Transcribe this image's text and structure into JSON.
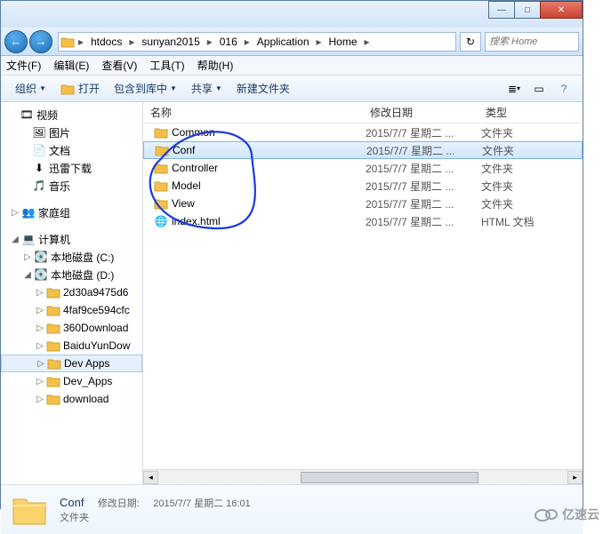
{
  "window": {
    "min": "—",
    "max": "□",
    "close": "✕"
  },
  "nav": {
    "back": "←",
    "fwd": "→",
    "refresh": "↻"
  },
  "breadcrumb": [
    "htdocs",
    "sunyan2015",
    "016",
    "Application",
    "Home"
  ],
  "search": {
    "placeholder": "搜索 Home"
  },
  "menu": {
    "file": "文件(F)",
    "edit": "编辑(E)",
    "view": "查看(V)",
    "tools": "工具(T)",
    "help": "帮助(H)"
  },
  "toolbar": {
    "organize": "组织",
    "open": "打开",
    "include": "包含到库中",
    "share": "共享",
    "newfolder": "新建文件夹"
  },
  "sidebar": {
    "video": "视频",
    "pictures": "图片",
    "documents": "文档",
    "xunlei": "迅雷下载",
    "music": "音乐",
    "homegroup": "家庭组",
    "computer": "计算机",
    "driveC": "本地磁盘 (C:)",
    "driveD": "本地磁盘 (D:)",
    "d1": "2d30a9475d6",
    "d2": "4faf9ce594cfc",
    "d3": "360Download",
    "d4": "BaiduYunDow",
    "d5": "Dev Apps",
    "d6": "Dev_Apps",
    "d7": "download"
  },
  "columns": {
    "name": "名称",
    "date": "修改日期",
    "type": "类型"
  },
  "files": [
    {
      "name": "Common",
      "date": "2015/7/7 星期二 ...",
      "type": "文件夹",
      "icon": "folder",
      "selected": false
    },
    {
      "name": "Conf",
      "date": "2015/7/7 星期二 ...",
      "type": "文件夹",
      "icon": "folder",
      "selected": true
    },
    {
      "name": "Controller",
      "date": "2015/7/7 星期二 ...",
      "type": "文件夹",
      "icon": "folder",
      "selected": false
    },
    {
      "name": "Model",
      "date": "2015/7/7 星期二 ...",
      "type": "文件夹",
      "icon": "folder",
      "selected": false
    },
    {
      "name": "View",
      "date": "2015/7/7 星期二 ...",
      "type": "文件夹",
      "icon": "folder",
      "selected": false
    },
    {
      "name": "index.html",
      "date": "2015/7/7 星期二 ...",
      "type": "HTML 文档",
      "icon": "html",
      "selected": false
    }
  ],
  "details": {
    "name": "Conf",
    "type": "文件夹",
    "modlabel": "修改日期:",
    "modified": "2015/7/7 星期二 16:01"
  },
  "watermark": "亿速云"
}
